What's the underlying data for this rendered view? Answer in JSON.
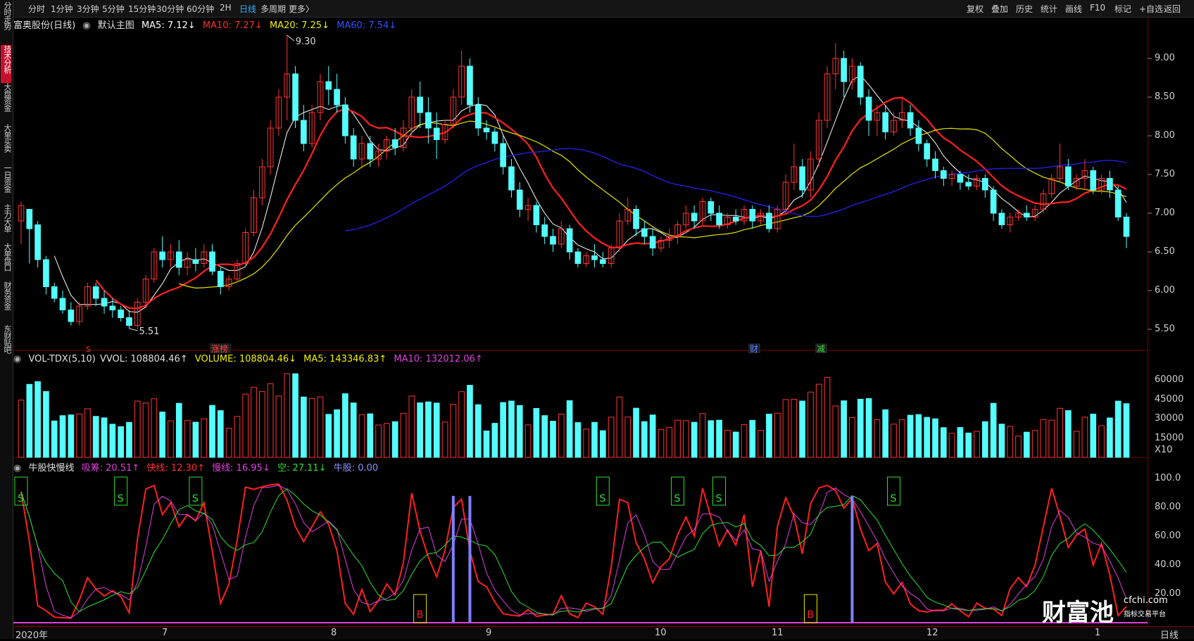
{
  "toolbar": {
    "periods": [
      "分时",
      "1分钟",
      "3分钟",
      "5分钟",
      "15分钟",
      "30分钟",
      "60分钟",
      "2H",
      "日线",
      "多周期",
      "更多〉"
    ],
    "active_period": "日线",
    "actions": [
      "复权",
      "叠加",
      "历史",
      "统计",
      "画线",
      "F10",
      "标记",
      "+自选",
      "返回"
    ]
  },
  "left_tabs": [
    "分时走势",
    "技术分析",
    "大盘资金",
    "大单买卖",
    "一日资金",
    "主力大单",
    "大单盘口",
    "财务资金",
    "东财贴吧"
  ],
  "active_tab": "技术分析",
  "main": {
    "stock": "富奥股份(日线)",
    "template": "默认主图",
    "ma5": "MA5: 7.12↓",
    "ma10": "MA10: 7.27↓",
    "ma20": "MA20: 7.25↓",
    "ma60": "MA60: 7.54↓",
    "high_mark": "9.30",
    "low_mark": "5.51",
    "event_labels": [
      "涨榜",
      "财",
      "减"
    ],
    "s_mark": "S"
  },
  "volume": {
    "name": "VOL-TDX(5,10)",
    "vvol": "VVOL: 108804.46↑",
    "volume": "VOLUME: 108804.46↓",
    "ma5": "MA5: 143346.83↑",
    "ma10": "MA10: 132012.06↑",
    "unit": "X10"
  },
  "indicator": {
    "name": "牛股快慢线",
    "xichou": "吸筹: 20.51↑",
    "kuai": "快线: 12.30↑",
    "man": "慢线: 16.95↓",
    "kong": "空: 27.11↓",
    "niugu": "牛股: 0.00",
    "s_label": "S",
    "b_label": "B"
  },
  "axes": {
    "price_ticks": [
      "9.00",
      "8.50",
      "8.00",
      "7.50",
      "7.00",
      "6.50",
      "6.00",
      "5.50"
    ],
    "volume_ticks": [
      "60000",
      "45000",
      "30000",
      "15000"
    ],
    "indicator_ticks": [
      "100.0",
      "80.00",
      "60.00",
      "40.00",
      "20.00"
    ],
    "date_ticks": [
      "2020年",
      "7",
      "8",
      "9",
      "10",
      "11",
      "12",
      "1"
    ],
    "period_label": "日线"
  },
  "watermark": {
    "name": "财富池",
    "site": "cfchi.com",
    "slogan": "指标交易平台"
  },
  "colors": {
    "up": "#ff3333",
    "down": "#54ffff",
    "ma5": "#ffffff",
    "ma10": "#ff2020",
    "ma20": "#e6e600",
    "ma60": "#2020e0"
  },
  "chart_data": {
    "type": "candlestick",
    "price_range": [
      5.3,
      9.3
    ],
    "candles": [
      [
        6.9,
        7.15,
        7.1,
        6.6
      ],
      [
        7.05,
        7.05,
        6.8,
        6.35
      ],
      [
        6.85,
        6.9,
        6.4,
        6.3
      ],
      [
        6.4,
        6.45,
        6.05,
        5.95
      ],
      [
        6.05,
        6.1,
        5.9,
        5.85
      ],
      [
        5.9,
        6.0,
        5.75,
        5.7
      ],
      [
        5.75,
        5.85,
        5.6,
        5.55
      ],
      [
        5.6,
        5.85,
        5.8,
        5.55
      ],
      [
        5.8,
        6.1,
        6.05,
        5.75
      ],
      [
        6.05,
        6.1,
        5.9,
        5.8
      ],
      [
        5.9,
        6.0,
        5.8,
        5.7
      ],
      [
        5.8,
        5.9,
        5.75,
        5.65
      ],
      [
        5.75,
        5.8,
        5.65,
        5.6
      ],
      [
        5.65,
        5.75,
        5.55,
        5.51
      ],
      [
        5.55,
        5.9,
        5.85,
        5.5
      ],
      [
        5.85,
        6.2,
        6.15,
        5.8
      ],
      [
        6.15,
        6.55,
        6.5,
        6.1
      ],
      [
        6.5,
        6.7,
        6.4,
        6.3
      ],
      [
        6.4,
        6.6,
        6.5,
        6.3
      ],
      [
        6.5,
        6.65,
        6.3,
        6.2
      ],
      [
        6.3,
        6.5,
        6.4,
        6.2
      ],
      [
        6.4,
        6.55,
        6.35,
        6.25
      ],
      [
        6.35,
        6.6,
        6.5,
        6.3
      ],
      [
        6.5,
        6.6,
        6.25,
        6.2
      ],
      [
        6.25,
        6.3,
        6.05,
        5.95
      ],
      [
        6.05,
        6.2,
        6.15,
        6.0
      ],
      [
        6.15,
        6.4,
        6.35,
        6.1
      ],
      [
        6.35,
        6.8,
        6.75,
        6.3
      ],
      [
        6.75,
        7.3,
        7.2,
        6.7
      ],
      [
        7.2,
        7.7,
        7.6,
        7.1
      ],
      [
        7.6,
        8.2,
        8.1,
        7.5
      ],
      [
        8.1,
        8.6,
        8.5,
        8.0
      ],
      [
        8.5,
        9.3,
        8.8,
        8.2
      ],
      [
        8.8,
        8.9,
        8.2,
        8.1
      ],
      [
        8.2,
        8.4,
        7.9,
        7.8
      ],
      [
        7.9,
        8.4,
        8.3,
        7.85
      ],
      [
        8.3,
        8.8,
        8.7,
        8.2
      ],
      [
        8.7,
        8.9,
        8.6,
        8.4
      ],
      [
        8.6,
        8.8,
        8.4,
        8.3
      ],
      [
        8.4,
        8.5,
        8.0,
        7.9
      ],
      [
        8.0,
        8.1,
        7.7,
        7.6
      ],
      [
        7.7,
        8.0,
        7.9,
        7.6
      ],
      [
        7.9,
        8.0,
        7.7,
        7.6
      ],
      [
        7.7,
        7.9,
        7.8,
        7.6
      ],
      [
        7.8,
        8.0,
        7.95,
        7.7
      ],
      [
        7.95,
        8.1,
        7.85,
        7.75
      ],
      [
        7.85,
        8.2,
        8.1,
        7.8
      ],
      [
        8.1,
        8.6,
        8.5,
        8.0
      ],
      [
        8.5,
        8.7,
        8.3,
        8.1
      ],
      [
        8.3,
        8.5,
        8.1,
        7.9
      ],
      [
        8.1,
        8.3,
        7.95,
        7.7
      ],
      [
        7.95,
        8.2,
        8.15,
        7.9
      ],
      [
        8.15,
        8.6,
        8.5,
        8.1
      ],
      [
        8.5,
        9.1,
        8.9,
        8.4
      ],
      [
        8.9,
        9.0,
        8.4,
        8.3
      ],
      [
        8.4,
        8.5,
        8.1,
        8.0
      ],
      [
        8.1,
        8.2,
        8.05,
        7.95
      ],
      [
        8.05,
        8.1,
        7.9,
        7.8
      ],
      [
        7.9,
        8.0,
        7.6,
        7.5
      ],
      [
        7.6,
        7.7,
        7.3,
        7.2
      ],
      [
        7.3,
        7.4,
        7.05,
        6.95
      ],
      [
        7.05,
        7.2,
        7.1,
        6.9
      ],
      [
        7.1,
        7.15,
        6.85,
        6.75
      ],
      [
        6.85,
        6.95,
        6.7,
        6.6
      ],
      [
        6.7,
        6.8,
        6.6,
        6.5
      ],
      [
        6.6,
        6.9,
        6.8,
        6.55
      ],
      [
        6.8,
        6.85,
        6.5,
        6.4
      ],
      [
        6.5,
        6.55,
        6.35,
        6.3
      ],
      [
        6.35,
        6.5,
        6.45,
        6.3
      ],
      [
        6.45,
        6.6,
        6.4,
        6.3
      ],
      [
        6.4,
        6.5,
        6.35,
        6.3
      ],
      [
        6.35,
        6.6,
        6.55,
        6.3
      ],
      [
        6.55,
        7.0,
        6.9,
        6.5
      ],
      [
        6.9,
        7.2,
        7.05,
        6.85
      ],
      [
        7.05,
        7.1,
        6.8,
        6.7
      ],
      [
        6.8,
        6.9,
        6.7,
        6.6
      ],
      [
        6.7,
        6.8,
        6.55,
        6.45
      ],
      [
        6.55,
        6.7,
        6.65,
        6.5
      ],
      [
        6.65,
        6.8,
        6.7,
        6.55
      ],
      [
        6.7,
        6.9,
        6.85,
        6.6
      ],
      [
        6.85,
        7.1,
        7.0,
        6.8
      ],
      [
        7.0,
        7.1,
        6.9,
        6.8
      ],
      [
        6.9,
        7.2,
        7.15,
        6.85
      ],
      [
        7.15,
        7.2,
        7.0,
        6.9
      ],
      [
        7.0,
        7.1,
        6.85,
        6.8
      ],
      [
        6.85,
        7.0,
        6.95,
        6.8
      ],
      [
        6.95,
        7.05,
        6.9,
        6.85
      ],
      [
        6.9,
        7.1,
        7.05,
        6.85
      ],
      [
        7.05,
        7.1,
        6.9,
        6.8
      ],
      [
        6.9,
        7.05,
        7.0,
        6.85
      ],
      [
        7.0,
        7.1,
        6.8,
        6.75
      ],
      [
        6.8,
        7.1,
        7.05,
        6.75
      ],
      [
        7.05,
        7.5,
        7.4,
        7.0
      ],
      [
        7.4,
        7.9,
        7.6,
        7.3
      ],
      [
        7.6,
        7.7,
        7.3,
        7.2
      ],
      [
        7.3,
        7.8,
        7.7,
        7.2
      ],
      [
        7.7,
        8.3,
        8.2,
        7.6
      ],
      [
        8.2,
        8.9,
        8.8,
        8.1
      ],
      [
        8.8,
        9.2,
        9.0,
        8.6
      ],
      [
        9.0,
        9.1,
        8.7,
        8.5
      ],
      [
        8.7,
        9.0,
        8.9,
        8.6
      ],
      [
        8.9,
        8.95,
        8.5,
        8.4
      ],
      [
        8.5,
        8.6,
        8.2,
        8.0
      ],
      [
        8.2,
        8.4,
        8.3,
        8.0
      ],
      [
        8.3,
        8.4,
        8.05,
        7.95
      ],
      [
        8.05,
        8.3,
        8.2,
        8.0
      ],
      [
        8.2,
        8.5,
        8.3,
        8.1
      ],
      [
        8.3,
        8.4,
        8.1,
        8.0
      ],
      [
        8.1,
        8.2,
        7.9,
        7.8
      ],
      [
        7.9,
        7.95,
        7.7,
        7.6
      ],
      [
        7.7,
        7.8,
        7.55,
        7.45
      ],
      [
        7.55,
        7.6,
        7.45,
        7.35
      ],
      [
        7.45,
        7.55,
        7.5,
        7.35
      ],
      [
        7.5,
        7.55,
        7.4,
        7.3
      ],
      [
        7.4,
        7.5,
        7.35,
        7.3
      ],
      [
        7.35,
        7.5,
        7.45,
        7.3
      ],
      [
        7.45,
        7.5,
        7.3,
        7.2
      ],
      [
        7.3,
        7.35,
        7.0,
        6.9
      ],
      [
        7.0,
        7.05,
        6.85,
        6.8
      ],
      [
        6.85,
        7.0,
        6.95,
        6.75
      ],
      [
        6.95,
        7.05,
        7.0,
        6.9
      ],
      [
        7.0,
        7.1,
        6.95,
        6.9
      ],
      [
        6.95,
        7.1,
        7.05,
        6.9
      ],
      [
        7.05,
        7.3,
        7.25,
        7.0
      ],
      [
        7.25,
        7.5,
        7.45,
        7.2
      ],
      [
        7.45,
        7.9,
        7.6,
        7.4
      ],
      [
        7.6,
        7.7,
        7.35,
        7.3
      ],
      [
        7.35,
        7.5,
        7.45,
        7.3
      ],
      [
        7.45,
        7.7,
        7.55,
        7.3
      ],
      [
        7.55,
        7.6,
        7.3,
        7.25
      ],
      [
        7.3,
        7.5,
        7.45,
        7.25
      ],
      [
        7.45,
        7.55,
        7.3,
        7.2
      ],
      [
        7.3,
        7.35,
        6.95,
        6.9
      ],
      [
        6.95,
        7.0,
        6.7,
        6.55
      ]
    ]
  }
}
